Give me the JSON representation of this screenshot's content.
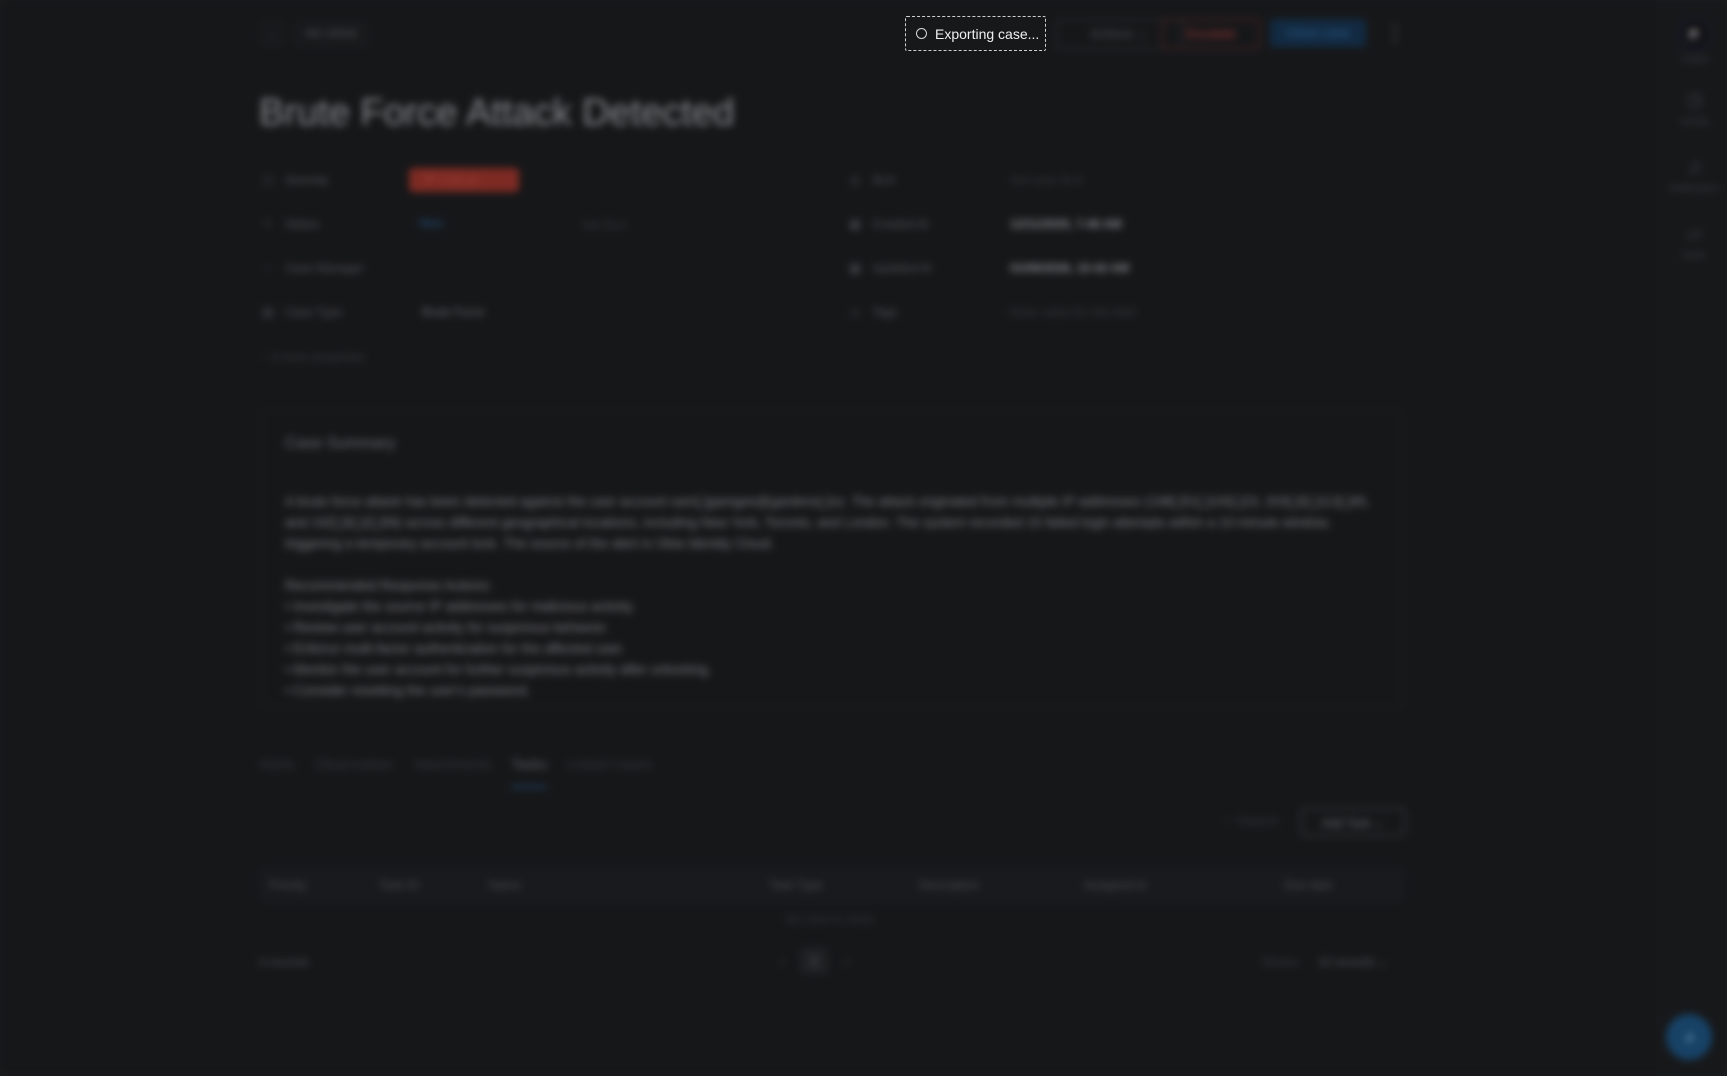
{
  "header": {
    "back_icon": "chevron-left-icon",
    "back_glyph": "‹",
    "case_id": "INC-00042",
    "actions_label": "Actions",
    "escalate_label": "Escalate",
    "close_case_label": "Close case",
    "kebab_icon": "more-vertical-icon",
    "kebab_glyph": "⋮"
  },
  "case_title": "Brute Force Attack Detected",
  "properties": {
    "severity_label": "Severity",
    "severity_value": "Critical",
    "status_label": "Status",
    "status_value": "New",
    "set_sla_inline": "Set SLA",
    "case_manager_label": "Case Manager",
    "case_type_label": "Case Type",
    "case_type_value": "Brute Force",
    "sla_label": "SLA",
    "sla_value": "Set case SLA",
    "created_label": "Created At",
    "created_value": "12/11/2025, 7:46 AM",
    "updated_label": "Updated At",
    "updated_value": "01/06/2026, 10:42 AM",
    "tags_label": "Tags",
    "tags_placeholder": "Enter value for this field",
    "more_properties": "6 more properties"
  },
  "summary": {
    "title": "Case Summary",
    "paragraph": "A brute force attack has been detected against the user account sam[.]gamgee@gardens[.]nz. The attack originated from multiple IP addresses (198[.]51[.]100[.]23, 203[.]0[.]113[.]45, and 192[.]0[.]2[.]56) across different geographical locations, including New York, Toronto, and London. The system recorded 15 failed login attempts within a 10-minute window, triggering a temporary account lock. The source of the alert is Okta Identity Cloud.",
    "actions_heading": "Recommended Response Actions:",
    "actions": [
      "• Investigate the source IP addresses for malicious activity.",
      "• Review user account activity for suspicious behavior.",
      "• Enforce multi-factor authentication for the affected user.",
      "• Monitor the user account for further suspicious activity after unlocking.",
      "• Consider resetting the user's password."
    ]
  },
  "tabs": [
    "Alerts",
    "Observables",
    "Attachments",
    "Tasks",
    "Linked Cases"
  ],
  "active_tab": "Tasks",
  "tasks": {
    "search_placeholder": "Search",
    "add_task_label": "Add Task",
    "columns": [
      "Priority",
      "Task ID",
      "Name",
      "Task Type",
      "Description",
      "Assigned to",
      "Due date"
    ],
    "empty_text": "No rows to show",
    "records_text": "0 records",
    "page_number": "1",
    "shows_label": "Shows",
    "per_page": "10 records"
  },
  "rail": [
    {
      "label": "Copilot",
      "icon": "copilot-icon"
    },
    {
      "label": "Activity",
      "icon": "clock-icon"
    },
    {
      "label": "Notifications",
      "icon": "bell-icon"
    },
    {
      "label": "Notes",
      "icon": "note-icon"
    }
  ],
  "toast": {
    "text": "Exporting case...",
    "icon": "spinner-icon"
  },
  "colors": {
    "background": "#1b1c1e",
    "critical": "#b8392d",
    "accent": "#2f6fb0"
  }
}
